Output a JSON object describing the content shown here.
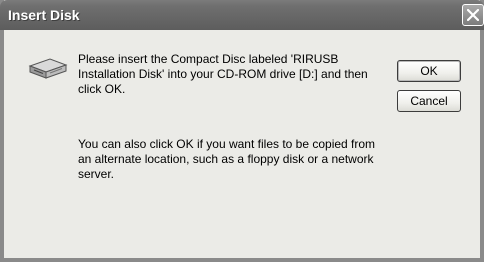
{
  "dialog": {
    "title": "Insert Disk",
    "message": "Please insert the Compact Disc labeled 'RIRUSB Installation Disk' into your CD-ROM drive [D:] and then click OK.",
    "secondary_message": "You can also click OK if you want files to be copied from an alternate location, such as a floppy disk or a network server.",
    "ok_label": "OK",
    "cancel_label": "Cancel",
    "icon": "cd-drive-icon"
  }
}
